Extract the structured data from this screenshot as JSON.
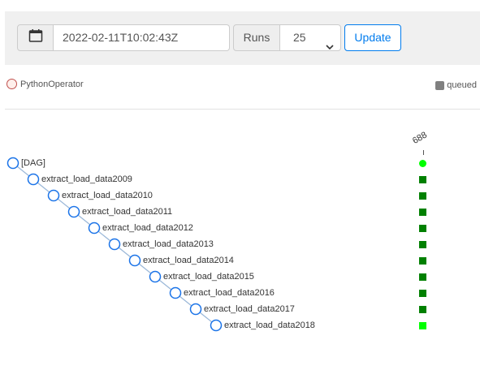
{
  "toolbar": {
    "date_value": "2022-02-11T10:02:43Z",
    "runs_label": "Runs",
    "runs_selected": "25",
    "update_label": "Update",
    "calendar_icon": "calendar-icon",
    "chevron_icon": "chevron-down-icon"
  },
  "legend": {
    "operator": {
      "label": "PythonOperator",
      "stroke": "#c0504d",
      "fill": "#ffefeb"
    },
    "state": {
      "label": "queued",
      "color": "#808080"
    }
  },
  "run": {
    "id": "688"
  },
  "tree": {
    "nodes": [
      {
        "label": "[DAG]",
        "status": "running"
      },
      {
        "label": "extract_load_data2009",
        "status": "success"
      },
      {
        "label": "extract_load_data2010",
        "status": "success"
      },
      {
        "label": "extract_load_data2011",
        "status": "success"
      },
      {
        "label": "extract_load_data2012",
        "status": "success"
      },
      {
        "label": "extract_load_data2013",
        "status": "success"
      },
      {
        "label": "extract_load_data2014",
        "status": "success"
      },
      {
        "label": "extract_load_data2015",
        "status": "success"
      },
      {
        "label": "extract_load_data2016",
        "status": "success"
      },
      {
        "label": "extract_load_data2017",
        "status": "success"
      },
      {
        "label": "extract_load_data2018",
        "status": "running"
      }
    ]
  },
  "colors": {
    "node_stroke": "#1a73e8",
    "link": "#9ab7d8",
    "success": "#008000",
    "running": "#00ff00",
    "accent": "#017cee"
  }
}
